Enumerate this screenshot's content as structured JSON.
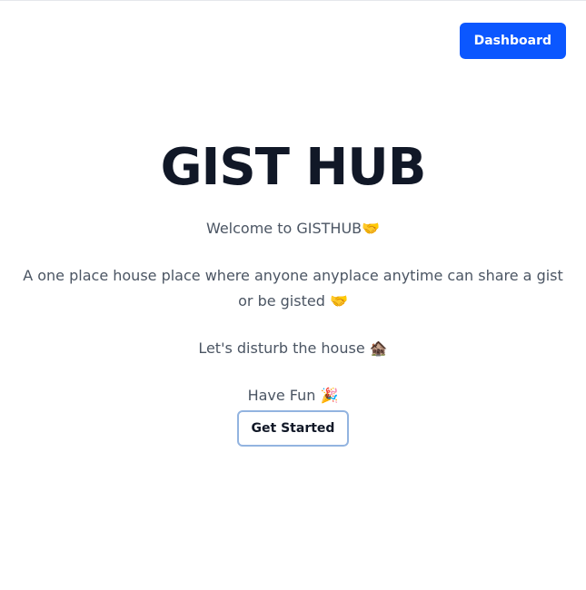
{
  "header": {
    "dashboard_label": "Dashboard"
  },
  "hero": {
    "title": "GIST HUB",
    "welcome": "Welcome to GISTHUB🤝",
    "description": "A one place house place where anyone anyplace anytime can share a gist or be gisted 🤝",
    "disturb": "Let's disturb the house 🏚️",
    "have_fun": "Have Fun 🎉",
    "cta_label": "Get Started"
  },
  "colors": {
    "primary": "#0b57ff",
    "title_text": "#111827",
    "body_text": "#4b5563",
    "cta_border": "#93b4e0"
  }
}
